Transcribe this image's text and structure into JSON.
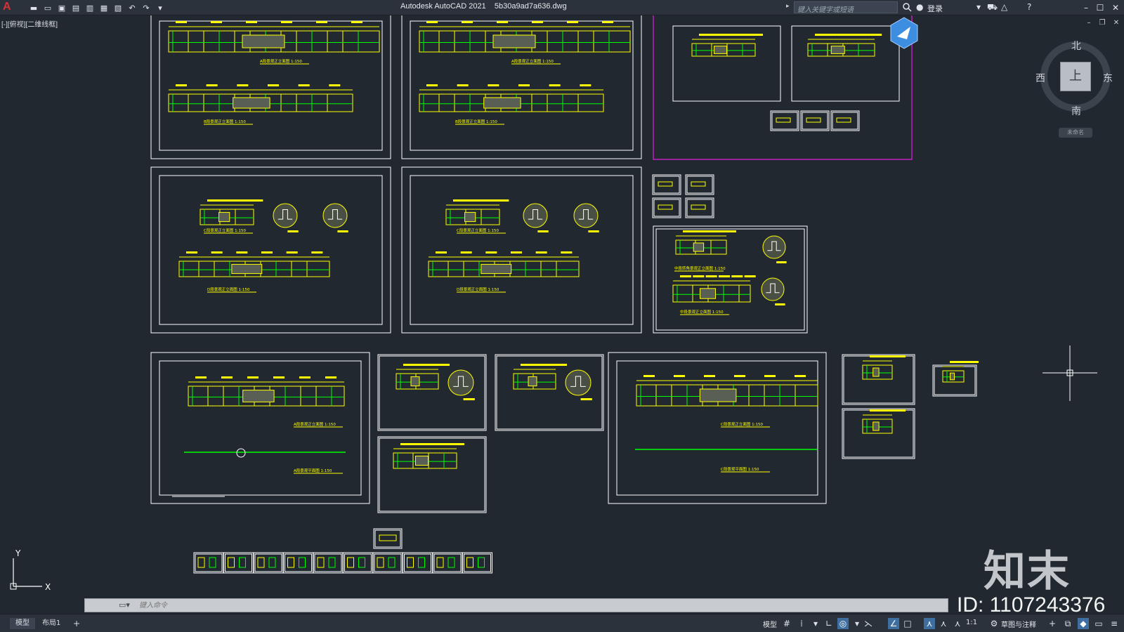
{
  "titlebar": {
    "app_logo": "A",
    "title": "Autodesk AutoCAD 2021    5b30a9ad7a636.dwg",
    "search_placeholder": "键入关键字或短语",
    "login_label": "登录",
    "quick_access": [
      "new-icon",
      "open-icon",
      "save-icon",
      "saveas-icon",
      "plot-icon",
      "publish-icon",
      "print-icon",
      "undo-icon",
      "redo-icon",
      "customize-icon"
    ]
  },
  "viewport": {
    "label": "[-][俯视][二维线框]"
  },
  "viewcube": {
    "north": "北",
    "south": "南",
    "east": "东",
    "west": "西",
    "face": "上",
    "wcs": "未命名"
  },
  "drawing": {
    "sheet_titles": [
      "A段景观正立面图 1:150",
      "B段景观正立面图 1:150",
      "A段景观正立面图 1:150",
      "B段景观正立面图 1:150",
      "C段景观正立面图 1:150",
      "D段景观正立面图 1:150",
      "C段景观正立面图 1:150",
      "D段景观正立面图 1:150",
      "中段转角景观正立面图 1:150",
      "中段景观正立面图 1:150",
      "A段景观正立面图 1:150",
      "A段景观平面图 1:150",
      "C段景观正立面图 1:150",
      "C段景观平面图 1:150"
    ],
    "colors": {
      "background": "#212830",
      "frame": "#ffffff",
      "primary": "#ffff00",
      "accent": "#00ff00",
      "highlight_frame": "#c020c0",
      "dim": "#ff3030"
    }
  },
  "ucs": {
    "x_label": "X",
    "y_label": "Y"
  },
  "command": {
    "placeholder": "键入命令"
  },
  "statusbar": {
    "tabs": [
      "模型",
      "布局1",
      "+"
    ],
    "model_label": "模型",
    "scale": "1:1",
    "workspace": "草图与注释"
  },
  "watermark": {
    "brand": "知末",
    "id": "ID: 1107243376"
  }
}
